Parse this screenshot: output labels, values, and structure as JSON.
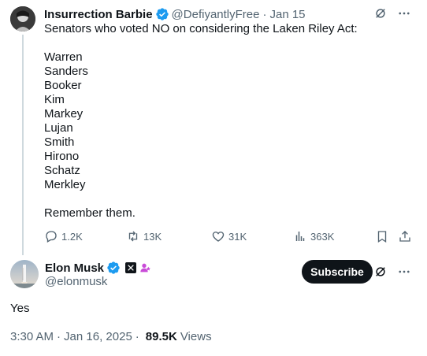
{
  "parent_tweet": {
    "author_name": "Insurrection Barbie",
    "handle": "@DefiyantlyFree",
    "separator": "·",
    "date": "Jan 15",
    "text": "Senators who voted NO on considering the Laken Riley Act:\n\nWarren\nSanders\nBooker\nKim\nMarkey\nLujan\nSmith\nHirono\nSchatz\nMerkley\n\nRemember them.",
    "stats": {
      "replies": "1.2K",
      "retweets": "13K",
      "likes": "31K",
      "views": "363K"
    }
  },
  "main_tweet": {
    "author_name": "Elon Musk",
    "handle": "@elonmusk",
    "subscribe_label": "Subscribe",
    "text": "Yes",
    "time": "3:30 AM",
    "separator": "·",
    "date": "Jan 16, 2025",
    "separator2": "·",
    "views_count": "89.5K",
    "views_label": "Views"
  },
  "colors": {
    "verified_blue": "#1d9bf0",
    "text_primary": "#0f1419",
    "text_secondary": "#536471",
    "thread_line": "#cfd9de",
    "org_badge": "#c94bd8"
  },
  "icons": [
    "grok-icon",
    "more-icon",
    "reply-icon",
    "retweet-icon",
    "like-icon",
    "views-icon",
    "bookmark-icon",
    "share-icon",
    "verified-badge-icon",
    "x-affiliate-icon",
    "org-badge-icon"
  ]
}
